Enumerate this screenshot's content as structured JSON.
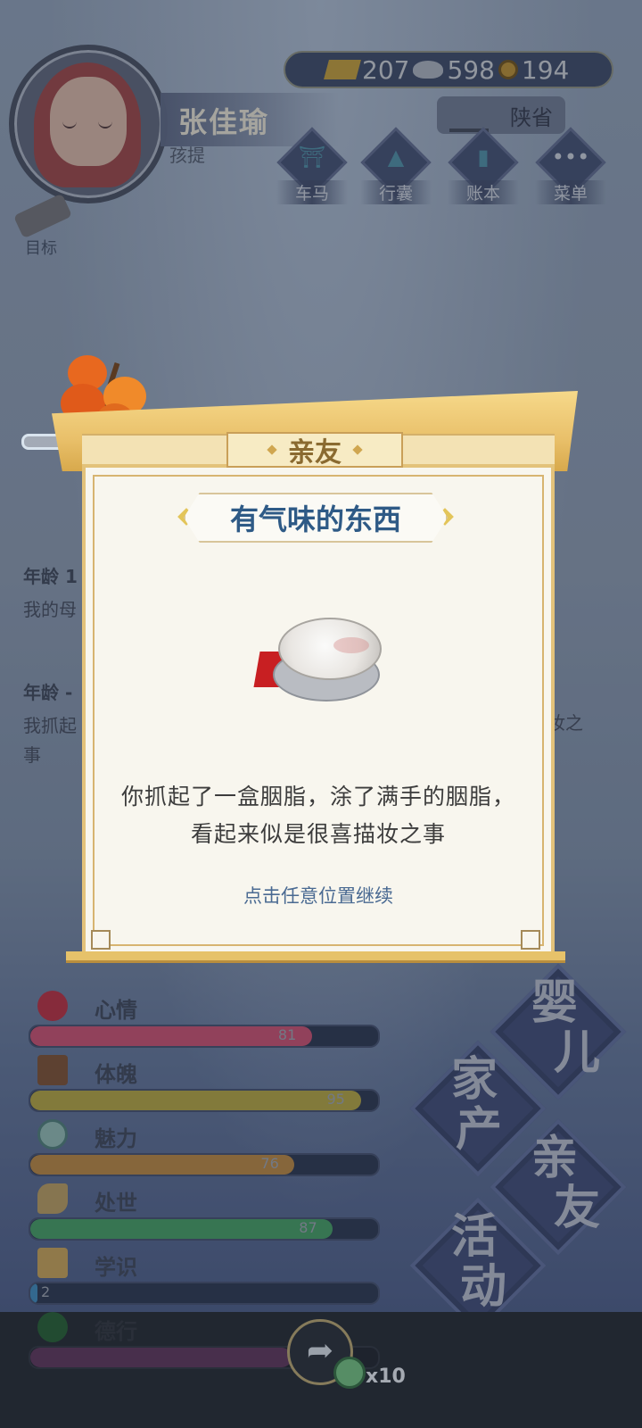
{
  "player": {
    "name": "张佳瑜",
    "title": "孩提"
  },
  "currency": {
    "gold": "207",
    "silver": "598",
    "coins": "194"
  },
  "region": "陕省",
  "menu": [
    {
      "label": "车马",
      "icon": "carriage-icon"
    },
    {
      "label": "行囊",
      "icon": "bag-icon"
    },
    {
      "label": "账本",
      "icon": "ledger-icon"
    },
    {
      "label": "菜单",
      "icon": "more-icon"
    }
  ],
  "goal_label": "目标",
  "log": [
    {
      "age": "年龄 1",
      "text": "我的母"
    },
    {
      "age": "年龄 -",
      "text": "我抓起",
      "tail": "妆之",
      "line2": "事"
    }
  ],
  "stats": [
    {
      "label": "心情",
      "value": 81,
      "color": "#c94a6a"
    },
    {
      "label": "体魄",
      "value": 95,
      "color": "#b3a13a"
    },
    {
      "label": "魅力",
      "value": 76,
      "color": "#b8833a"
    },
    {
      "label": "处世",
      "value": 87,
      "color": "#3f9a5c"
    },
    {
      "label": "学识",
      "value": 2,
      "color": "#3a86b8"
    },
    {
      "label": "德行",
      "value": 75,
      "color": "#5a2f54"
    }
  ],
  "nav": [
    {
      "text": [
        "婴",
        "儿"
      ]
    },
    {
      "text": [
        "家",
        "产"
      ]
    },
    {
      "text": [
        "亲",
        "友"
      ]
    },
    {
      "text": [
        "活",
        "动"
      ]
    }
  ],
  "modal": {
    "tab": "亲友",
    "title": "有气味的东西",
    "description": "你抓起了一盒胭脂，涂了满手的胭脂，看起来似是很喜描妆之事",
    "hint": "点击任意位置继续"
  },
  "reward": {
    "count": "x10"
  },
  "colors": {
    "title_blue": "#2e5a86",
    "gold_trim": "#e3c27a"
  }
}
